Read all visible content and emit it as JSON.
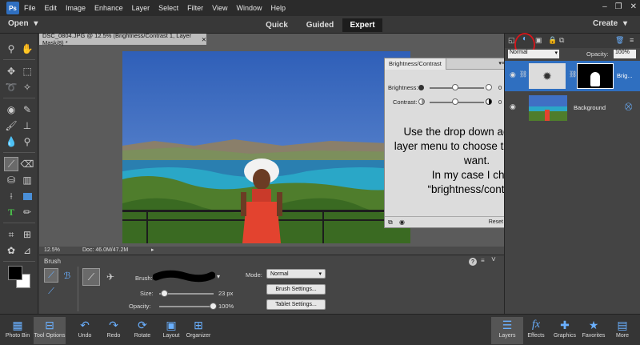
{
  "menu": {
    "logo": "Ps",
    "items": [
      "File",
      "Edit",
      "Image",
      "Enhance",
      "Layer",
      "Select",
      "Filter",
      "View",
      "Window",
      "Help"
    ],
    "window_controls": [
      "–",
      "❐",
      "✕"
    ]
  },
  "modebar": {
    "open_label": "Open",
    "open_arrow": "▾",
    "modes": [
      "Quick",
      "Guided",
      "Expert"
    ],
    "active_mode": "Expert",
    "create_label": "Create",
    "create_arrow": "▾"
  },
  "document": {
    "tab_title": "DSC_0804.JPG @ 12.5% (Brightness/Contrast 1, Layer Mask/8) *",
    "close": "✕",
    "zoom": "12.5%",
    "doc_size": "Doc: 46.0M/47.2M",
    "status_arrow": "▸"
  },
  "adjustment_panel": {
    "tab_label": "Brightness/Contrast",
    "menu": "▾≡",
    "brightness_label": "Brightness:",
    "brightness_value": "0",
    "contrast_label": "Contrast:",
    "contrast_value": "0",
    "reset_label": "Reset"
  },
  "annotation": {
    "line1": "Use the drop down adjustment",
    "line2": "layer menu to choose the type you want.",
    "line3": "In my case I chose “brightness/contrast”"
  },
  "layers_panel": {
    "blend_mode": "Normal",
    "opacity_label": "Opacity:",
    "opacity_value": "100%",
    "adjustment_layer_name": "Brig...",
    "background_layer_name": "Background",
    "dropdown_arrow": "▾"
  },
  "tool_options": {
    "tool_name": "Brush",
    "brush_label": "Brush:",
    "size_label": "Size:",
    "size_value": "23 px",
    "size_fraction": 0.1,
    "opacity_label": "Opacity:",
    "opacity_value": "100%",
    "opacity_fraction": 1.0,
    "mode_label": "Mode:",
    "mode_value": "Normal",
    "brush_settings_label": "Brush Settings...",
    "tablet_settings_label": "Tablet Settings...",
    "help": "?",
    "menu": "≡",
    "collapse": "˅",
    "dropdown_arrow": "▾"
  },
  "bottom_bar": {
    "left": [
      "Photo Bin",
      "Tool Options",
      "Undo",
      "Redo",
      "Rotate",
      "Layout",
      "Organizer"
    ],
    "right": [
      "Layers",
      "Effects",
      "Graphics",
      "Favorites",
      "More"
    ]
  },
  "colors": {
    "accent_blue": "#4a8fd8",
    "annotation_circle": "#d9151b",
    "sky": "#3f6fc4",
    "panel_light": "#dcdcdc"
  }
}
